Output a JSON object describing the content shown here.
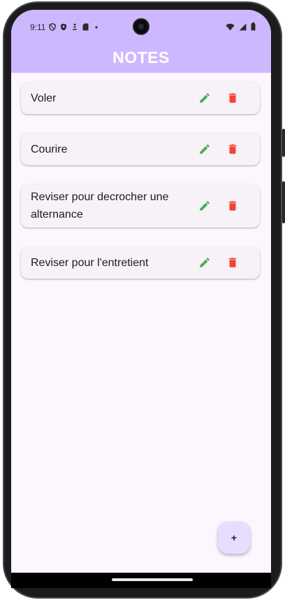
{
  "status_bar": {
    "time": "9:11",
    "left_icons": [
      "shield-outline-icon",
      "shield-icon",
      "download-icon",
      "sd-card-icon",
      "dot-icon"
    ],
    "right_icons": [
      "wifi-icon",
      "signal-icon",
      "battery-icon"
    ]
  },
  "app_bar": {
    "title": "NOTES"
  },
  "notes": [
    {
      "text": "Voler"
    },
    {
      "text": "Courire"
    },
    {
      "text": "Reviser pour decrocher une alternance"
    },
    {
      "text": "Reviser pour l'entretient"
    }
  ],
  "fab": {
    "label": "+"
  },
  "colors": {
    "app_bar": "#cdb8ff",
    "background": "#fdf6ff",
    "card": "#f7f1f8",
    "edit_icon": "#4caf50",
    "delete_icon": "#f44336",
    "fab": "#e8ddff"
  }
}
